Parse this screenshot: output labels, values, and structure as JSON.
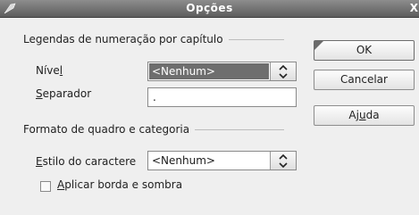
{
  "window": {
    "title": "Opções",
    "close_glyph": "X"
  },
  "numbering": {
    "heading": "Legendas de numeração por capítulo",
    "level_label_pre": "Níve",
    "level_label_mnemonic": "l",
    "level_value": "<Nenhum>",
    "separator_label_mnemonic": "S",
    "separator_label_post": "eparador",
    "separator_value": "."
  },
  "frame": {
    "heading": "Formato de quadro e categoria",
    "char_style_label_mnemonic": "E",
    "char_style_label_post": "stilo do caractere",
    "char_style_value": "<Nenhum>",
    "apply_border_mnemonic": "A",
    "apply_border_post": "plicar borda e sombra",
    "apply_border_checked": false
  },
  "buttons": {
    "ok": "OK",
    "cancel": "Cancelar",
    "help_pre": "Aj",
    "help_mnemonic": "u",
    "help_post": "da"
  }
}
